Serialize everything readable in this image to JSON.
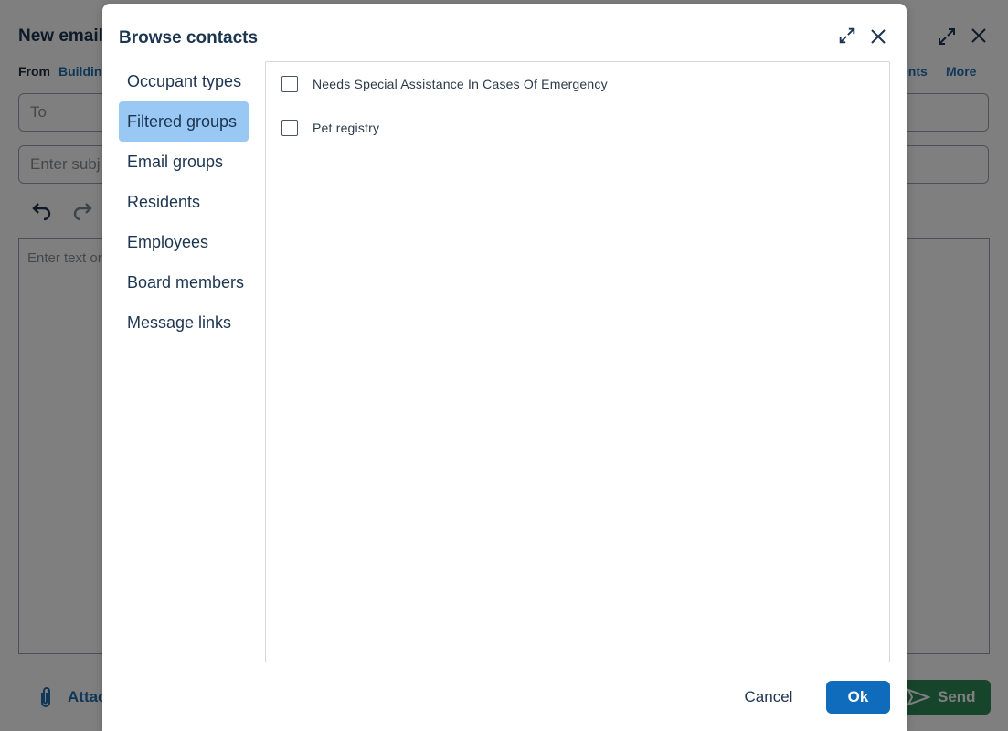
{
  "background": {
    "title": "New email",
    "from_label": "From",
    "from_value": "Buildin",
    "link_ents": "ents",
    "link_more": "More",
    "to_placeholder": "To",
    "subject_placeholder": "Enter subj",
    "body_placeholder": "Enter text or",
    "attach_label": "Attac",
    "send_label": "Send"
  },
  "dialog": {
    "title": "Browse contacts",
    "nav": [
      {
        "label": "Occupant types",
        "active": false
      },
      {
        "label": "Filtered groups",
        "active": true
      },
      {
        "label": "Email groups",
        "active": false
      },
      {
        "label": "Residents",
        "active": false
      },
      {
        "label": "Employees",
        "active": false
      },
      {
        "label": "Board members",
        "active": false
      },
      {
        "label": "Message links",
        "active": false
      }
    ],
    "options": [
      {
        "label": "Needs Special Assistance In Cases Of Emergency",
        "checked": false
      },
      {
        "label": "Pet registry",
        "checked": false
      }
    ],
    "cancel_label": "Cancel",
    "ok_label": "Ok"
  },
  "colors": {
    "accent": "#0f6cbd",
    "active_nav": "#99c8f5",
    "send_green": "#2e8a58",
    "title_text": "#1c3550"
  }
}
